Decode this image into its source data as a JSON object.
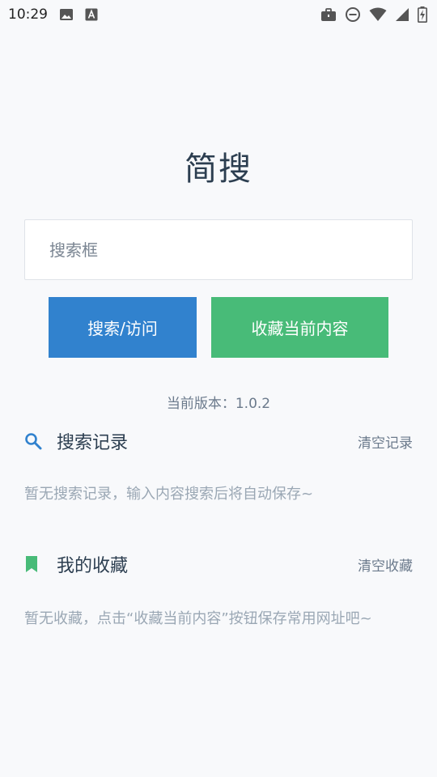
{
  "status_bar": {
    "time": "10:29",
    "icons_left": [
      "image-icon",
      "font-a-icon"
    ],
    "icons_right": [
      "briefcase-icon",
      "do-not-disturb-icon",
      "wifi-icon",
      "signal-icon",
      "battery-charging-icon"
    ]
  },
  "app": {
    "title": "简搜"
  },
  "search": {
    "placeholder": "搜索框",
    "value": ""
  },
  "buttons": {
    "search_label": "搜索/访问",
    "favorite_label": "收藏当前内容"
  },
  "version_text": "当前版本：1.0.2",
  "history": {
    "title": "搜索记录",
    "clear_label": "清空记录",
    "empty_text": "暂无搜索记录，输入内容搜索后将自动保存~",
    "icon": "search-icon"
  },
  "favorites": {
    "title": "我的收藏",
    "clear_label": "清空收藏",
    "empty_text": "暂无收藏，点击“收藏当前内容”按钮保存常用网址吧~",
    "icon": "bookmark-icon"
  },
  "colors": {
    "background": "#f8f9fb",
    "primary_blue": "#3182ce",
    "primary_green": "#48bb78",
    "title_text": "#2c3e50",
    "muted_text": "#9aa7b4"
  }
}
